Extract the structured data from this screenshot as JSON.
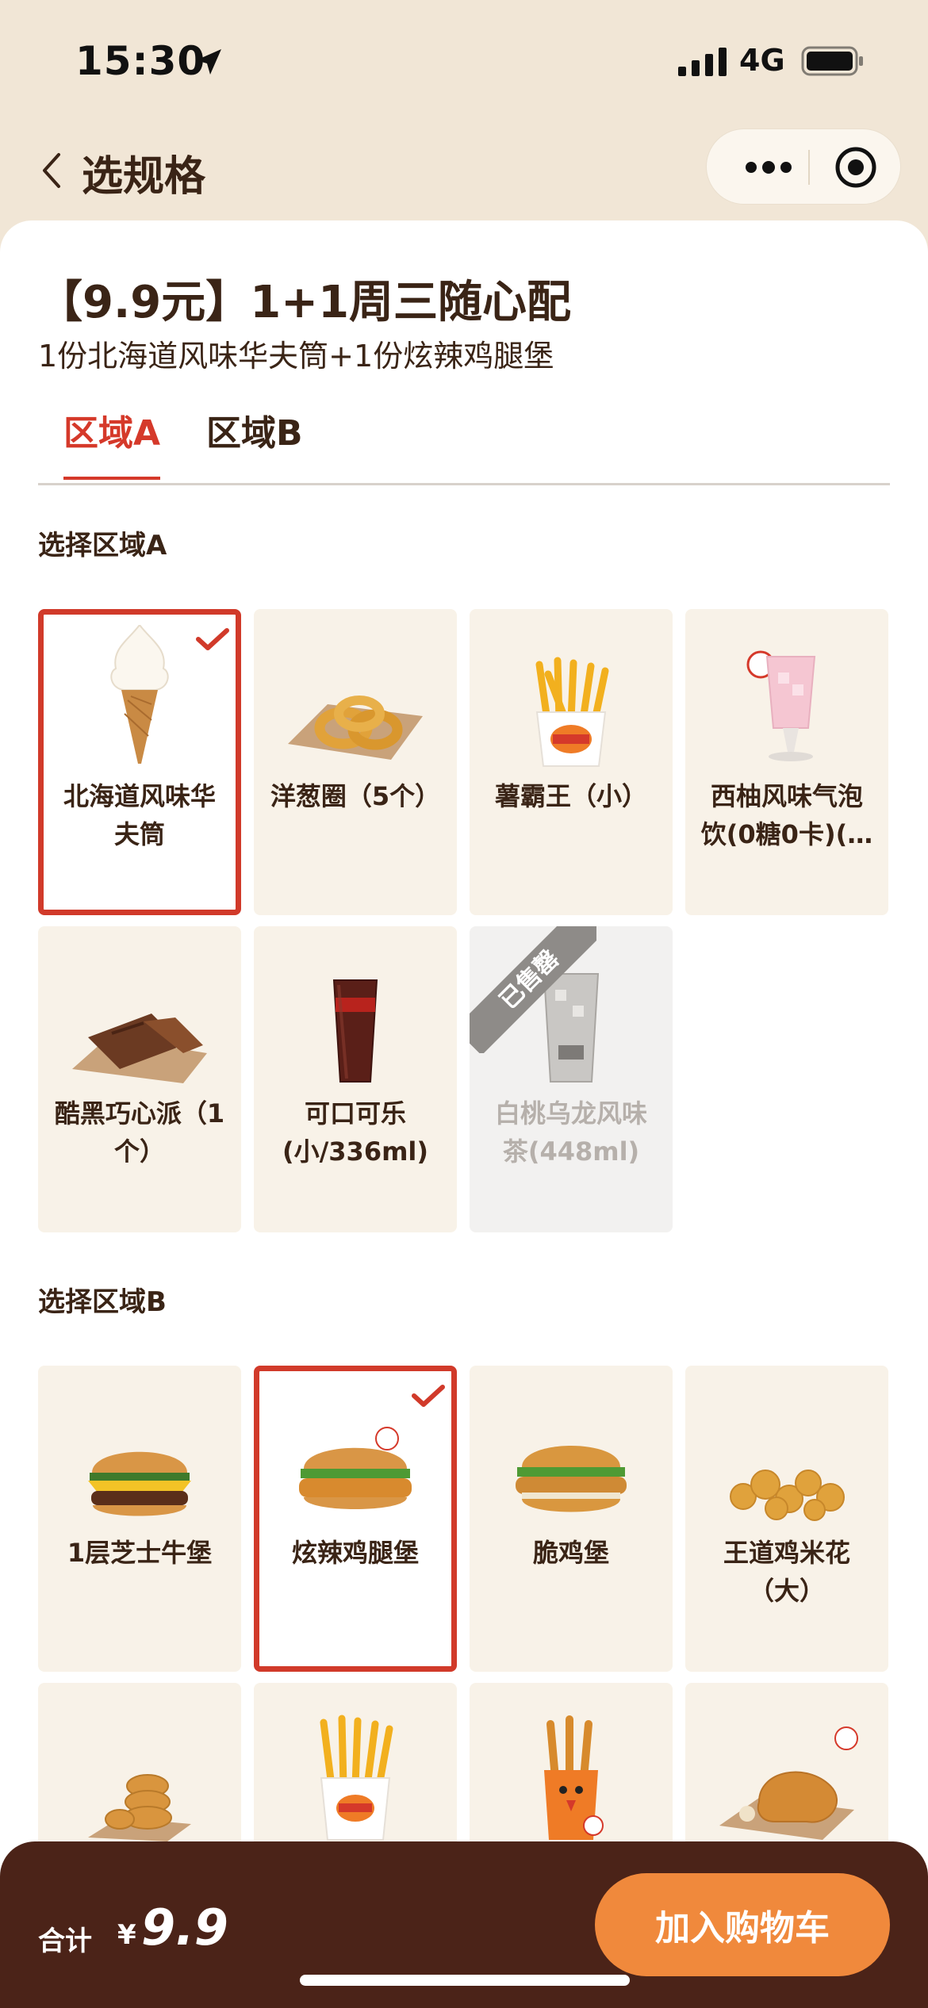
{
  "status_bar": {
    "time": "15:30",
    "network": "4G"
  },
  "nav": {
    "title": "选规格"
  },
  "deal": {
    "title": "【9.9元】1+1周三随心配",
    "subtitle": "1份北海道风味华夫筒+1份炫辣鸡腿堡"
  },
  "tabs": [
    {
      "label": "区域A",
      "active": true
    },
    {
      "label": "区域B",
      "active": false
    }
  ],
  "section_a": {
    "label": "选择区域A",
    "items": [
      {
        "name": "北海道风味华\n夫筒",
        "selected": true,
        "soldout": false,
        "icon": "ice-cream-cone-icon"
      },
      {
        "name": "洋葱圈（5个）",
        "selected": false,
        "soldout": false,
        "icon": "onion-rings-icon"
      },
      {
        "name": "薯霸王（小）",
        "selected": false,
        "soldout": false,
        "icon": "fries-icon"
      },
      {
        "name": "西柚风味气泡饮(0糖0卡)(…",
        "selected": false,
        "soldout": false,
        "icon": "pink-drink-icon"
      },
      {
        "name": "酷黑巧心派（1个）",
        "selected": false,
        "soldout": false,
        "icon": "chocolate-pie-icon"
      },
      {
        "name": "可口可乐(小/336ml)",
        "selected": false,
        "soldout": false,
        "icon": "cola-icon"
      },
      {
        "name": "白桃乌龙风味茶(448ml)",
        "selected": false,
        "soldout": true,
        "soldout_label": "已售罄",
        "icon": "tea-icon"
      }
    ]
  },
  "section_b": {
    "label": "选择区域B",
    "items": [
      {
        "name": "1层芝士牛堡",
        "selected": false,
        "icon": "cheeseburger-icon"
      },
      {
        "name": "炫辣鸡腿堡",
        "selected": true,
        "icon": "spicy-chicken-burger-icon"
      },
      {
        "name": "脆鸡堡",
        "selected": false,
        "icon": "chicken-burger-icon"
      },
      {
        "name": "王道鸡米花（大）",
        "selected": false,
        "icon": "popcorn-chicken-icon"
      },
      {
        "name": "",
        "selected": false,
        "icon": "nuggets-icon"
      },
      {
        "name": "",
        "selected": false,
        "icon": "fries-icon"
      },
      {
        "name": "",
        "selected": false,
        "icon": "chicken-fries-icon"
      },
      {
        "name": "",
        "selected": false,
        "icon": "chicken-leg-icon"
      }
    ]
  },
  "footer": {
    "total_label": "合计",
    "currency": "¥",
    "price": "9.9",
    "add_to_cart": "加入购物车"
  },
  "colors": {
    "accent_red": "#d5392a",
    "cart_orange": "#f0893c",
    "footer_brown": "#4b2318",
    "page_bg": "#f1e6d6"
  }
}
